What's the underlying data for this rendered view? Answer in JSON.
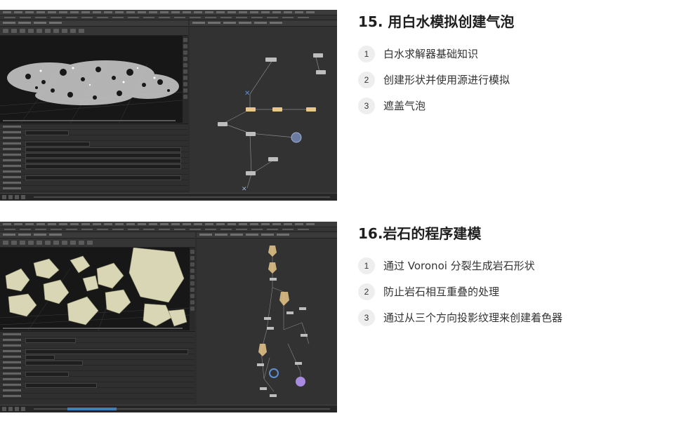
{
  "lessons": [
    {
      "title": "15. 用白水模拟创建气泡",
      "items": [
        {
          "num": "1",
          "text": "白水求解器基础知识"
        },
        {
          "num": "2",
          "text": "创建形状并使用源进行模拟"
        },
        {
          "num": "3",
          "text": "遮盖气泡"
        }
      ]
    },
    {
      "title": "16.岩石的程序建模",
      "items": [
        {
          "num": "1",
          "text": "通过 Voronoi 分裂生成岩石形状"
        },
        {
          "num": "2",
          "text": "防止岩石相互重叠的处理"
        },
        {
          "num": "3",
          "text": "通过从三个方向投影纹理来创建着色器"
        }
      ]
    }
  ],
  "colors": {
    "accent_node": "#e8c88a",
    "selected_node": "#5b8fd8",
    "highlight_node": "#a78be0",
    "rock_fill": "#d8d6b4",
    "number_badge": "#eeeeee"
  }
}
